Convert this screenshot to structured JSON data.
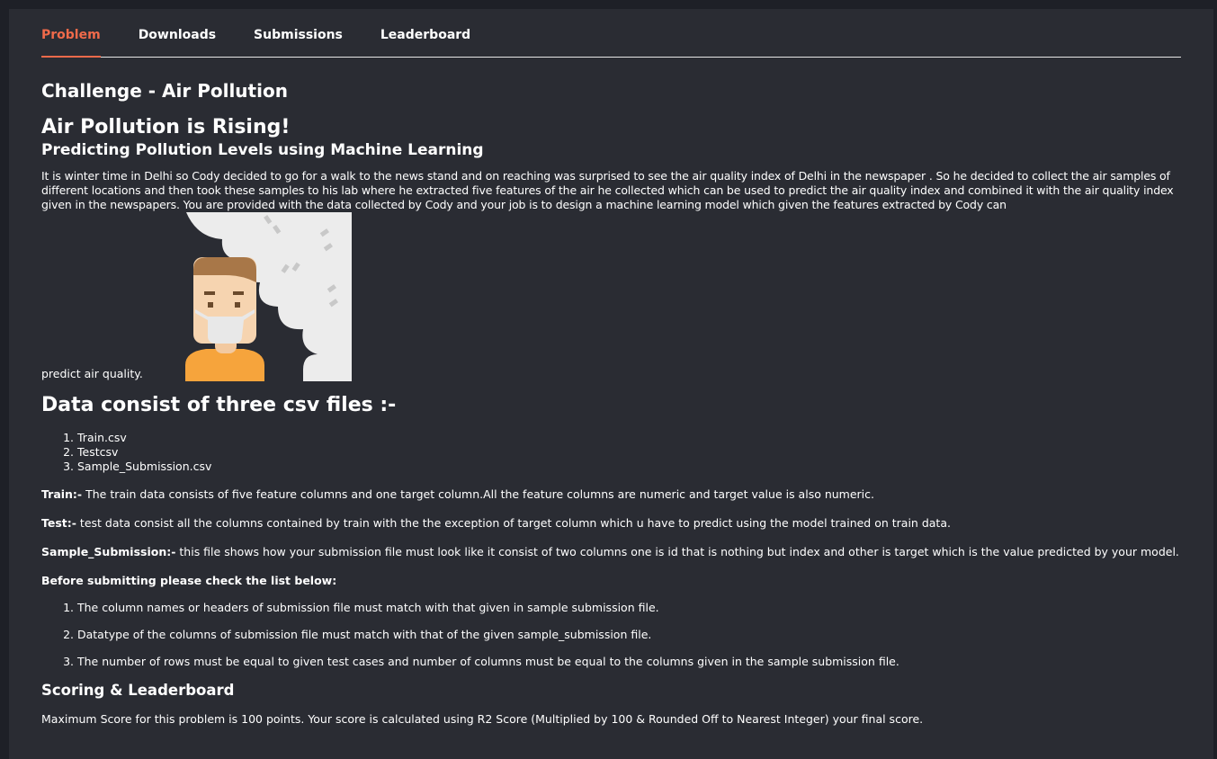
{
  "tabs": [
    {
      "label": "Problem",
      "active": true
    },
    {
      "label": "Downloads",
      "active": false
    },
    {
      "label": "Submissions",
      "active": false
    },
    {
      "label": "Leaderboard",
      "active": false
    }
  ],
  "challenge_title": "Challenge - Air Pollution",
  "heading": "Air Pollution is Rising!",
  "subheading": "Predicting Pollution Levels using Machine Learning",
  "description": "It is winter time in Delhi so Cody decided to go for a walk to the news stand and on reaching was surprised to see the air quality index of Delhi in the newspaper . So he decided to collect the air samples of different locations and then took these samples to his lab where he extracted five features of the air he collected which can be used to predict the air quality index and combined it with the air quality index given in the newspapers. You are provided with the data collected by Cody and your job is to design a machine learning model which given the features extracted by Cody can",
  "description_tail": "predict air quality.",
  "data_heading": "Data consist of three csv files :-",
  "files": [
    "Train.csv",
    "Testcsv",
    "Sample_Submission.csv"
  ],
  "train": {
    "label": "Train:-",
    "text": " The train data consists of five feature columns and one target column.All the feature columns are numeric and target value is also numeric."
  },
  "test": {
    "label": "Test:-",
    "text": " test data consist all the columns contained by train with the the exception of target column which u have to predict using the model trained on train data."
  },
  "sample": {
    "label": "Sample_Submission:-",
    "text": " this file shows how your submission file must look like it consist of two columns one is id that is nothing but index and other is target which is the value predicted by your model."
  },
  "check_title": "Before submitting please check the list below:",
  "checks": [
    "The column names or headers of submission file must match with that given in sample submission file.",
    "Datatype of the columns of submission file must match with that of the given sample_submission file.",
    "The number of rows must be equal to given test cases and number of columns must be equal to the columns given in the sample submission file."
  ],
  "scoring_heading": "Scoring & Leaderboard",
  "scoring_text": "Maximum Score for this problem is 100 points. Your score is calculated using R2 Score (Multiplied by 100 & Rounded Off to Nearest Integer) your final score.",
  "illustration_icon": "masked-person-smog-illustration",
  "colors": {
    "accent": "#f06a4a",
    "background": "#2a2c33",
    "page": "#1e2027"
  }
}
